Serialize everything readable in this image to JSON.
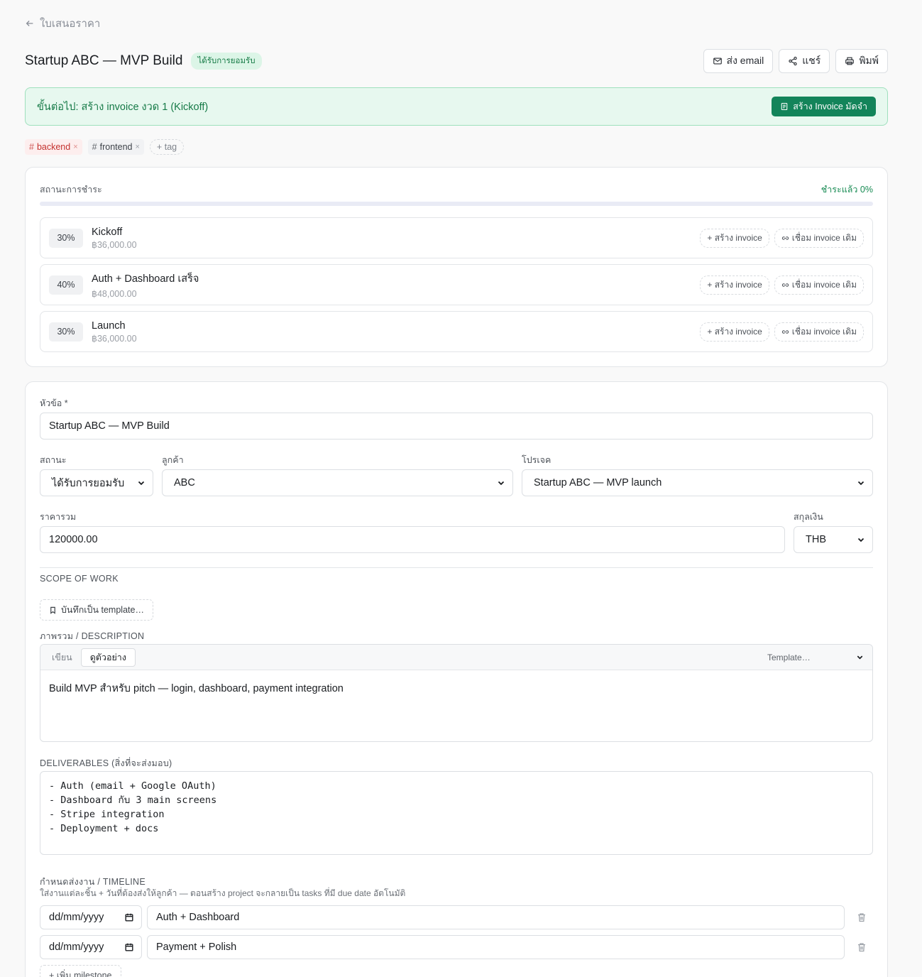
{
  "back": {
    "label": "ใบเสนอราคา"
  },
  "header": {
    "title": "Startup ABC — MVP Build",
    "status_badge": "ได้รับการยอมรับ",
    "actions": {
      "email": "ส่ง email",
      "share": "แชร์",
      "print": "พิมพ์"
    }
  },
  "next_step": {
    "text": "ขั้นต่อไป: สร้าง invoice งวด 1 (Kickoff)",
    "button": "สร้าง Invoice มัดจำ"
  },
  "tags": {
    "items": [
      {
        "name": "backend",
        "color": "#c4312e"
      },
      {
        "name": "frontend",
        "color": "#3e434a"
      }
    ],
    "add_label": "tag"
  },
  "payment": {
    "heading": "สถานะการชำระ",
    "paid_label": "ชำระแล้ว 0%",
    "paid_fraction": 0,
    "milestones": [
      {
        "percent": "30%",
        "name": "Kickoff",
        "amount": "฿36,000.00",
        "create_label": "+ สร้าง invoice",
        "link_label": "เชื่อม invoice เดิม"
      },
      {
        "percent": "40%",
        "name": "Auth + Dashboard เสร็จ",
        "amount": "฿48,000.00",
        "create_label": "+ สร้าง invoice",
        "link_label": "เชื่อม invoice เดิม"
      },
      {
        "percent": "30%",
        "name": "Launch",
        "amount": "฿36,000.00",
        "create_label": "+ สร้าง invoice",
        "link_label": "เชื่อม invoice เดิม"
      }
    ]
  },
  "form": {
    "subject_label": "หัวข้อ *",
    "subject_value": "Startup ABC — MVP Build",
    "status_label": "สถานะ",
    "status_value": "ได้รับการยอมรับ",
    "client_label": "ลูกค้า",
    "client_value": "ABC",
    "project_label": "โปรเจค",
    "project_value": "Startup ABC — MVP launch",
    "total_label": "ราคารวม",
    "total_value": "120000.00",
    "currency_label": "สกุลเงิน",
    "currency_value": "THB",
    "scope_heading": "SCOPE OF WORK",
    "save_template": "บันทึกเป็น template…",
    "description_heading": "ภาพรวม / DESCRIPTION",
    "editor": {
      "tab_write": "เขียน",
      "tab_preview": "ดูตัวอย่าง",
      "template_select": "Template…",
      "body": "Build MVP สำหรับ pitch — login, dashboard, payment integration"
    },
    "deliverables_heading": "DELIVERABLES (สิ่งที่จะส่งมอบ)",
    "deliverables": [
      "- Auth (email + Google OAuth)",
      "- Dashboard กับ 3 main screens",
      "- Stripe integration",
      "- Deployment + docs"
    ],
    "timeline_heading": "กำหนดส่งงาน / TIMELINE",
    "timeline_hint": "ใส่งานแต่ละชิ้น + วันที่ต้องส่งให้ลูกค้า — ตอนสร้าง project จะกลายเป็น tasks ที่มี due date อัตโนมัติ",
    "timeline": [
      {
        "date": "dd/mm/yyyy",
        "task": "Auth + Dashboard"
      },
      {
        "date": "dd/mm/yyyy",
        "task": "Payment + Polish"
      }
    ],
    "add_milestone": "+ เพิ่ม milestone"
  }
}
